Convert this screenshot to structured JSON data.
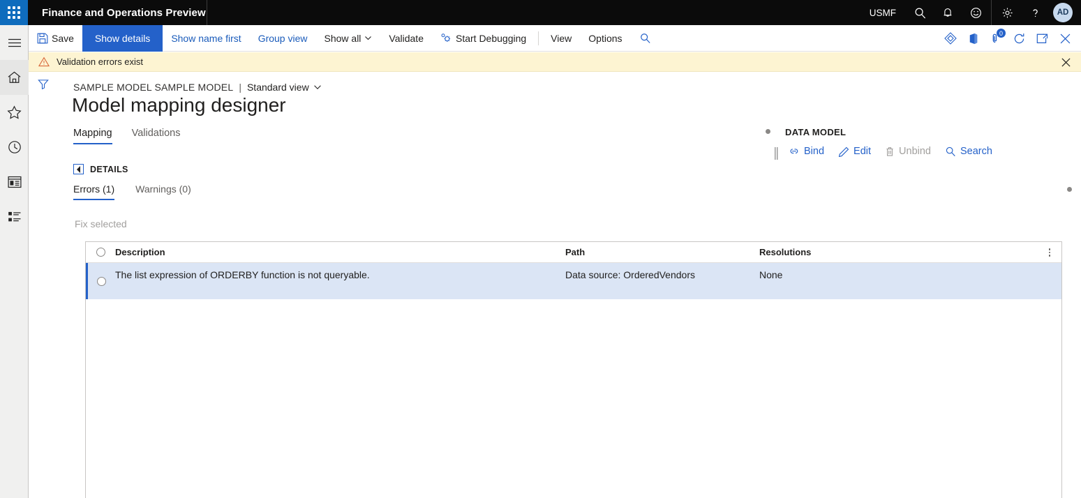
{
  "header": {
    "waffle_icon": "waffle-grid-icon",
    "app_title": "Finance and Operations Preview",
    "company": "USMF",
    "icons": [
      {
        "name": "search-icon",
        "label": "Search"
      },
      {
        "name": "notifications-bell-icon",
        "label": "Notifications"
      },
      {
        "name": "feedback-smiley-icon",
        "label": "Feedback"
      },
      {
        "name": "settings-gear-icon",
        "label": "Settings"
      },
      {
        "name": "help-question-icon",
        "label": "Help"
      }
    ],
    "avatar_initials": "AD"
  },
  "navrail": {
    "items": [
      {
        "name": "hamburger-menu-icon",
        "label": "Expand the navigation pane"
      },
      {
        "name": "home-icon",
        "label": "Home"
      },
      {
        "name": "favorites-star-icon",
        "label": "Favorites"
      },
      {
        "name": "recent-clock-icon",
        "label": "Recent"
      },
      {
        "name": "workspaces-icon",
        "label": "Workspaces"
      },
      {
        "name": "modules-list-icon",
        "label": "Modules"
      }
    ]
  },
  "commandbar": {
    "save_label": "Save",
    "show_details_label": "Show details",
    "show_name_first_label": "Show name first",
    "group_view_label": "Group view",
    "show_all_label": "Show all",
    "validate_label": "Validate",
    "start_debugging_label": "Start Debugging",
    "view_label": "View",
    "options_label": "Options",
    "search_icon": "search-icon",
    "right_icons": [
      {
        "name": "powerbi-diamond-icon",
        "label": "Power BI"
      },
      {
        "name": "office-app-icon",
        "label": "Open in Microsoft Office"
      },
      {
        "name": "attachments-icon",
        "label": "Attachments",
        "badge": "0"
      },
      {
        "name": "refresh-icon",
        "label": "Refresh"
      },
      {
        "name": "popout-window-icon",
        "label": "Open in new window"
      },
      {
        "name": "close-icon",
        "label": "Close"
      }
    ]
  },
  "messagebar": {
    "warning_icon": "warning-triangle-icon",
    "text": "Validation errors exist",
    "close_icon": "close-icon"
  },
  "filterstrip": {
    "filter_icon": "filter-funnel-icon"
  },
  "page": {
    "breadcrumb_model": "SAMPLE MODEL SAMPLE MODEL",
    "breadcrumb_separator": "|",
    "breadcrumb_view": "Standard view",
    "breadcrumb_chevron_icon": "chevron-down-icon",
    "title": "Model mapping designer",
    "tabs": [
      {
        "label": "Mapping",
        "active": true
      },
      {
        "label": "Validations",
        "active": false
      }
    ]
  },
  "datamodel": {
    "title": "DATA MODEL",
    "grip_icon": "drag-grip-icon",
    "actions": [
      {
        "label": "Bind",
        "icon": "bind-link-icon",
        "disabled": false
      },
      {
        "label": "Edit",
        "icon": "edit-pencil-icon",
        "disabled": false
      },
      {
        "label": "Unbind",
        "icon": "unbind-trash-icon",
        "disabled": true
      },
      {
        "label": "Search",
        "icon": "search-icon",
        "disabled": false
      }
    ]
  },
  "details": {
    "expander_icon": "collapse-triangle-icon",
    "section_label": "DETAILS",
    "subtabs": [
      {
        "label": "Errors (1)",
        "active": true
      },
      {
        "label": "Warnings (0)",
        "active": false
      }
    ],
    "fix_selected_label": "Fix selected",
    "grid": {
      "select_all_icon": "radio-unselected-icon",
      "columns": [
        {
          "label": "Description"
        },
        {
          "label": "Path"
        },
        {
          "label": "Resolutions"
        }
      ],
      "more_icon": "column-options-icon",
      "rows": [
        {
          "selector_icon": "radio-unselected-icon",
          "description": "The list expression of ORDERBY function is not queryable.",
          "path": "Data source: OrderedVendors",
          "resolutions": "None",
          "selected": true
        }
      ]
    }
  },
  "colors": {
    "brand_blue": "#2461c9",
    "link_blue": "#1b5cbb",
    "header_black": "#0b0b0b",
    "waffle_blue": "#0f6cbd",
    "warning_bg": "#fdf4d2",
    "row_selected_bg": "#dbe5f5"
  }
}
